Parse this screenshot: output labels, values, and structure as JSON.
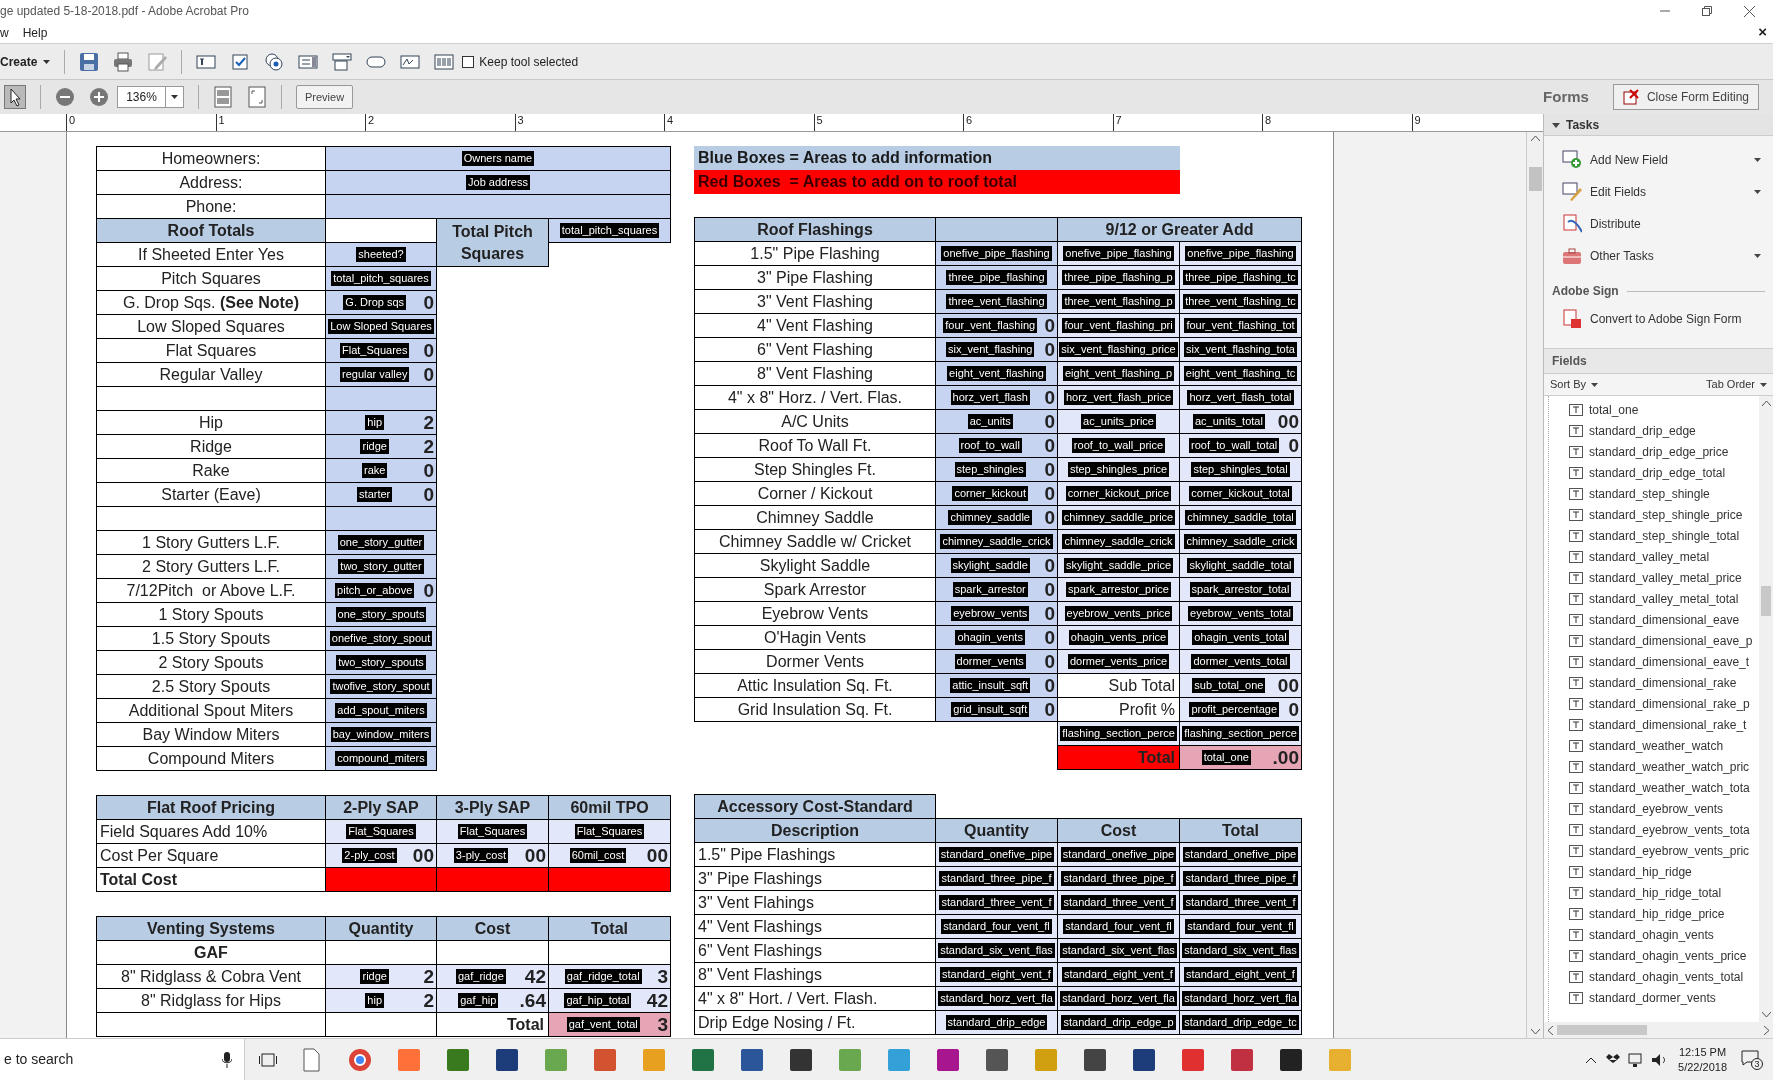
{
  "window": {
    "title": "ge updated 5-18-2018.pdf - Adobe Acrobat Pro",
    "menu": [
      "w",
      "Help"
    ],
    "menu_close": "×"
  },
  "toolbar": {
    "create": "Create",
    "keep_tool": {
      "label": "Keep tool selected",
      "checked": false
    }
  },
  "view_toolbar": {
    "zoom": "136%",
    "preview": "Preview"
  },
  "ruler": [
    "0",
    "1",
    "2",
    "3",
    "4",
    "5",
    "6",
    "7",
    "8",
    "9"
  ],
  "form": {
    "left_table": [
      [
        {
          "kind": "label",
          "text": "Homeowners:"
        },
        {
          "kind": "input_wide",
          "tag": "Owners name"
        }
      ],
      [
        {
          "kind": "label",
          "text": "Address:"
        },
        {
          "kind": "input_wide",
          "tag": "Job address"
        }
      ],
      [
        {
          "kind": "label",
          "text": "Phone:"
        },
        {
          "kind": "input_wide"
        }
      ],
      [
        {
          "kind": "header",
          "text": "Roof Totals"
        },
        {
          "kind": "blank"
        },
        {
          "kind": "header_tall",
          "text": "Total Pitch Squares"
        },
        {
          "kind": "input",
          "tag": "total_pitch_squares"
        }
      ],
      [
        {
          "kind": "label",
          "text": "If Sheeted Enter Yes"
        },
        {
          "kind": "input",
          "tag": "sheeted?"
        }
      ],
      [
        {
          "kind": "label",
          "text": "Pitch Squares"
        },
        {
          "kind": "input",
          "tag": "total_pitch_squares"
        }
      ],
      [
        {
          "kind": "label",
          "text": "G. Drop Sqs. **(See Note)**"
        },
        {
          "kind": "input",
          "tag": "G. Drop sqs",
          "value": "0"
        }
      ],
      [
        {
          "kind": "label",
          "text": "Low Sloped Squares"
        },
        {
          "kind": "input",
          "tag": "Low Sloped Squares"
        }
      ],
      [
        {
          "kind": "label",
          "text": "Flat Squares"
        },
        {
          "kind": "input",
          "tag": "Flat_Squares",
          "value": "0"
        }
      ],
      [
        {
          "kind": "label",
          "text": "Regular Valley"
        },
        {
          "kind": "input",
          "tag": "regular valley",
          "value": "0"
        }
      ],
      [
        {
          "kind": "blank"
        },
        {
          "kind": "input"
        }
      ],
      [
        {
          "kind": "label",
          "text": "Hip"
        },
        {
          "kind": "input",
          "tag": "hip",
          "value": "2"
        }
      ],
      [
        {
          "kind": "label",
          "text": "Ridge"
        },
        {
          "kind": "input",
          "tag": "ridge",
          "value": "2"
        }
      ],
      [
        {
          "kind": "label",
          "text": "Rake"
        },
        {
          "kind": "input",
          "tag": "rake",
          "value": "0"
        }
      ],
      [
        {
          "kind": "label",
          "text": "Starter (Eave)"
        },
        {
          "kind": "input",
          "tag": "starter",
          "value": "0"
        }
      ],
      [
        {
          "kind": "blank"
        },
        {
          "kind": "input"
        }
      ],
      [
        {
          "kind": "label",
          "text": "1 Story Gutters L.F."
        },
        {
          "kind": "input",
          "tag": "one_story_gutter"
        }
      ],
      [
        {
          "kind": "label",
          "text": "2 Story Gutters L.F."
        },
        {
          "kind": "input",
          "tag": "two_story_gutter"
        }
      ],
      [
        {
          "kind": "label",
          "text": "7/12Pitch  or Above L.F."
        },
        {
          "kind": "input",
          "tag": "pitch_or_above",
          "value": "0"
        }
      ],
      [
        {
          "kind": "label",
          "text": "1 Story Spouts"
        },
        {
          "kind": "input",
          "tag": "one_story_spouts"
        }
      ],
      [
        {
          "kind": "label",
          "text": "1.5 Story Spouts"
        },
        {
          "kind": "input",
          "tag": "onefive_story_spout"
        }
      ],
      [
        {
          "kind": "label",
          "text": "2 Story Spouts"
        },
        {
          "kind": "input",
          "tag": "two_story_spouts"
        }
      ],
      [
        {
          "kind": "label",
          "text": "2.5 Story Spouts"
        },
        {
          "kind": "input",
          "tag": "twofive_story_spout"
        }
      ],
      [
        {
          "kind": "label",
          "text": "Additional Spout Miters"
        },
        {
          "kind": "input",
          "tag": "add_spout_miters"
        }
      ],
      [
        {
          "kind": "label",
          "text": "Bay Window Miters"
        },
        {
          "kind": "input",
          "tag": "bay_window_miters"
        }
      ],
      [
        {
          "kind": "label",
          "text": "Compound Miters"
        },
        {
          "kind": "input",
          "tag": "compound_miters"
        }
      ]
    ],
    "flat_roof_pricing": [
      [
        {
          "kind": "header",
          "text": "Flat Roof Pricing"
        },
        {
          "kind": "header",
          "text": "2-Ply SAP"
        },
        {
          "kind": "header",
          "text": "3-Ply SAP"
        },
        {
          "kind": "header",
          "text": "60mil TPO"
        }
      ],
      [
        {
          "kind": "label_left",
          "text": "Field Squares Add 10%"
        },
        {
          "kind": "price",
          "tag": "Flat_Squares"
        },
        {
          "kind": "price",
          "tag": "Flat_Squares"
        },
        {
          "kind": "price",
          "tag": "Flat_Squares"
        }
      ],
      [
        {
          "kind": "label_left",
          "text": "Cost Per Square"
        },
        {
          "kind": "price",
          "tag": "2-ply_cost",
          "value": "00"
        },
        {
          "kind": "price",
          "tag": "3-ply_cost",
          "value": "00"
        },
        {
          "kind": "price",
          "tag": "60mil_cost",
          "value": "00"
        }
      ],
      [
        {
          "kind": "label_bold_left",
          "text": "Total Cost"
        },
        {
          "kind": "red"
        },
        {
          "kind": "red"
        },
        {
          "kind": "red"
        }
      ]
    ],
    "venting_systems": [
      [
        {
          "kind": "header",
          "text": "Venting Systems"
        },
        {
          "kind": "header",
          "text": "Quantity"
        },
        {
          "kind": "header",
          "text": "Cost"
        },
        {
          "kind": "header",
          "text": "Total"
        }
      ],
      [
        {
          "kind": "label_bold",
          "text": "GAF"
        },
        {
          "kind": "blank"
        },
        {
          "kind": "blank"
        },
        {
          "kind": "blank"
        }
      ],
      [
        {
          "kind": "label",
          "text": "8\" Ridglass & Cobra Vent"
        },
        {
          "kind": "price",
          "tag": "ridge",
          "value": "2"
        },
        {
          "kind": "price",
          "tag": "gaf_ridge",
          "value": "42"
        },
        {
          "kind": "price",
          "tag": "gaf_ridge_total",
          "value": "3"
        }
      ],
      [
        {
          "kind": "label",
          "text": "8\" Ridglass for Hips"
        },
        {
          "kind": "price",
          "tag": "hip",
          "value": "2"
        },
        {
          "kind": "price",
          "tag": "gaf_hip",
          "value": ".64"
        },
        {
          "kind": "price",
          "tag": "gaf_hip_total",
          "value": "42"
        }
      ],
      [
        {
          "kind": "blank"
        },
        {
          "kind": "blank"
        },
        {
          "kind": "label_bold_right",
          "text": "Total"
        },
        {
          "kind": "pink",
          "tag": "gaf_vent_total",
          "value": "3"
        }
      ]
    ],
    "legend": [
      {
        "kind": "info",
        "text": "Blue Boxes = Areas to add information"
      },
      {
        "kind": "warning",
        "text": "Red Boxes  = Areas to add on to roof total"
      }
    ],
    "roof_flashings": [
      [
        {
          "kind": "header",
          "text": "Roof Flashings"
        },
        {
          "kind": "header"
        },
        {
          "kind": "header_wide",
          "text": "9/12 or Greater Add"
        }
      ],
      [
        {
          "kind": "label",
          "text": "1.5\" Pipe Flashing"
        },
        {
          "kind": "input",
          "tag": "onefive_pipe_flashing"
        },
        {
          "kind": "price",
          "tag": "onefive_pipe_flashing"
        },
        {
          "kind": "price",
          "tag": "onefive_pipe_flashing"
        }
      ],
      [
        {
          "kind": "label",
          "text": "3\" Pipe Flashing"
        },
        {
          "kind": "input",
          "tag": "three_pipe_flashing"
        },
        {
          "kind": "price",
          "tag": "three_pipe_flashing_p"
        },
        {
          "kind": "price",
          "tag": "three_pipe_flashing_tc"
        }
      ],
      [
        {
          "kind": "label",
          "text": "3\" Vent Flashing"
        },
        {
          "kind": "input",
          "tag": "three_vent_flashing"
        },
        {
          "kind": "price",
          "tag": "three_vent_flashing_p"
        },
        {
          "kind": "price",
          "tag": "three_vent_flashing_tc"
        }
      ],
      [
        {
          "kind": "label",
          "text": "4\" Vent Flashing"
        },
        {
          "kind": "input",
          "tag": "four_vent_flashing",
          "value": "0"
        },
        {
          "kind": "price",
          "tag": "four_vent_flashing_pri"
        },
        {
          "kind": "price",
          "tag": "four_vent_flashing_tot"
        }
      ],
      [
        {
          "kind": "label",
          "text": "6\" Vent Flashing"
        },
        {
          "kind": "input",
          "tag": "six_vent_flashing",
          "value": "0"
        },
        {
          "kind": "price",
          "tag": "six_vent_flashing_price"
        },
        {
          "kind": "price",
          "tag": "six_vent_flashing_tota"
        }
      ],
      [
        {
          "kind": "label",
          "text": "8\" Vent Flashing"
        },
        {
          "kind": "input",
          "tag": "eight_vent_flashing"
        },
        {
          "kind": "price",
          "tag": "eight_vent_flashing_p"
        },
        {
          "kind": "price",
          "tag": "eight_vent_flashing_tc"
        }
      ],
      [
        {
          "kind": "label",
          "text": "4\" x 8\" Horz. / Vert. Flas."
        },
        {
          "kind": "input",
          "tag": "horz_vert_flash",
          "value": "0"
        },
        {
          "kind": "price",
          "tag": "horz_vert_flash_price"
        },
        {
          "kind": "price",
          "tag": "horz_vert_flash_total"
        }
      ],
      [
        {
          "kind": "label",
          "text": "A/C Units"
        },
        {
          "kind": "input",
          "tag": "ac_units",
          "value": "0"
        },
        {
          "kind": "price",
          "tag": "ac_units_price"
        },
        {
          "kind": "price",
          "tag": "ac_units_total",
          "value": "00"
        }
      ],
      [
        {
          "kind": "label",
          "text": "Roof To Wall Ft."
        },
        {
          "kind": "input",
          "tag": "roof_to_wall",
          "value": "0"
        },
        {
          "kind": "price",
          "tag": "roof_to_wall_price"
        },
        {
          "kind": "price",
          "tag": "roof_to_wall_total",
          "value": "0"
        }
      ],
      [
        {
          "kind": "label",
          "text": "Step Shingles Ft."
        },
        {
          "kind": "input",
          "tag": "step_shingles",
          "value": "0"
        },
        {
          "kind": "price",
          "tag": "step_shingles_price"
        },
        {
          "kind": "price",
          "tag": "step_shingles_total"
        }
      ],
      [
        {
          "kind": "label",
          "text": "Corner / Kickout"
        },
        {
          "kind": "input",
          "tag": "corner_kickout",
          "value": "0"
        },
        {
          "kind": "price",
          "tag": "corner_kickout_price"
        },
        {
          "kind": "price",
          "tag": "corner_kickout_total"
        }
      ],
      [
        {
          "kind": "label",
          "text": "Chimney Saddle"
        },
        {
          "kind": "input",
          "tag": "chimney_saddle",
          "value": "0"
        },
        {
          "kind": "price",
          "tag": "chimney_saddle_price"
        },
        {
          "kind": "price",
          "tag": "chimney_saddle_total"
        }
      ],
      [
        {
          "kind": "label",
          "text": "Chimney Saddle w/ Cricket"
        },
        {
          "kind": "input",
          "tag": "chimney_saddle_crick"
        },
        {
          "kind": "price",
          "tag": "chimney_saddle_crick"
        },
        {
          "kind": "price",
          "tag": "chimney_saddle_crick"
        }
      ],
      [
        {
          "kind": "label",
          "text": "Skylight Saddle"
        },
        {
          "kind": "input",
          "tag": "skylight_saddle",
          "value": "0"
        },
        {
          "kind": "price",
          "tag": "skylight_saddle_price"
        },
        {
          "kind": "price",
          "tag": "skylight_saddle_total"
        }
      ],
      [
        {
          "kind": "label",
          "text": "Spark Arrestor"
        },
        {
          "kind": "input",
          "tag": "spark_arrestor",
          "value": "0"
        },
        {
          "kind": "price",
          "tag": "spark_arrestor_price"
        },
        {
          "kind": "price",
          "tag": "spark_arrestor_total"
        }
      ],
      [
        {
          "kind": "label",
          "text": "Eyebrow Vents"
        },
        {
          "kind": "input",
          "tag": "eyebrow_vents",
          "value": "0"
        },
        {
          "kind": "price",
          "tag": "eyebrow_vents_price"
        },
        {
          "kind": "price",
          "tag": "eyebrow_vents_total"
        }
      ],
      [
        {
          "kind": "label",
          "text": "O'Hagin Vents"
        },
        {
          "kind": "input",
          "tag": "ohagin_vents",
          "value": "0"
        },
        {
          "kind": "price",
          "tag": "ohagin_vents_price"
        },
        {
          "kind": "price",
          "tag": "ohagin_vents_total"
        }
      ],
      [
        {
          "kind": "label",
          "text": "Dormer Vents"
        },
        {
          "kind": "input",
          "tag": "dormer_vents",
          "value": "0"
        },
        {
          "kind": "price",
          "tag": "dormer_vents_price"
        },
        {
          "kind": "price",
          "tag": "dormer_vents_total"
        }
      ],
      [
        {
          "kind": "label",
          "text": "Attic Insulation Sq. Ft."
        },
        {
          "kind": "input",
          "tag": "attic_insult_sqft",
          "value": "0"
        },
        {
          "kind": "label_right",
          "text": "Sub Total"
        },
        {
          "kind": "price",
          "tag": "sub_total_one",
          "value": "00"
        }
      ],
      [
        {
          "kind": "label",
          "text": "Grid Insulation Sq. Ft."
        },
        {
          "kind": "input",
          "tag": "grid_insult_sqft",
          "value": "0"
        },
        {
          "kind": "label_right",
          "text": "Profit %"
        },
        {
          "kind": "price",
          "tag": "profit_percentage",
          "value": "0"
        }
      ],
      [
        {
          "kind": "none"
        },
        {
          "kind": "none"
        },
        {
          "kind": "price",
          "tag": "flashing_section_perce"
        },
        {
          "kind": "price",
          "tag": "flashing_section_perce"
        }
      ],
      [
        {
          "kind": "none"
        },
        {
          "kind": "none"
        },
        {
          "kind": "red",
          "text": "Total"
        },
        {
          "kind": "pink",
          "tag": "total_one",
          "value": ".00"
        }
      ]
    ],
    "accessory_cost": [
      [
        {
          "kind": "header",
          "text": "Accessory Cost-Standard"
        },
        {
          "kind": "none"
        },
        {
          "kind": "none"
        },
        {
          "kind": "none"
        }
      ],
      [
        {
          "kind": "header",
          "text": "Description"
        },
        {
          "kind": "header",
          "text": "Quantity"
        },
        {
          "kind": "header",
          "text": "Cost"
        },
        {
          "kind": "header",
          "text": "Total"
        }
      ],
      [
        {
          "kind": "label_left",
          "text": "1.5\" Pipe Flashings"
        },
        {
          "kind": "price",
          "tag": "standard_onefive_pipe"
        },
        {
          "kind": "price",
          "tag": "standard_onefive_pipe"
        },
        {
          "kind": "price",
          "tag": "standard_onefive_pipe"
        }
      ],
      [
        {
          "kind": "label_left",
          "text": "3\" Pipe Flashings"
        },
        {
          "kind": "price",
          "tag": "standard_three_pipe_f"
        },
        {
          "kind": "price",
          "tag": "standard_three_pipe_f"
        },
        {
          "kind": "price",
          "tag": "standard_three_pipe_f"
        }
      ],
      [
        {
          "kind": "label_left",
          "text": "3\" Vent Flahings"
        },
        {
          "kind": "price",
          "tag": "standard_three_vent_f"
        },
        {
          "kind": "price",
          "tag": "standard_three_vent_f"
        },
        {
          "kind": "price",
          "tag": "standard_three_vent_f"
        }
      ],
      [
        {
          "kind": "label_left",
          "text": "4\" Vent Flashings"
        },
        {
          "kind": "price",
          "tag": "standard_four_vent_fl"
        },
        {
          "kind": "price",
          "tag": "standard_four_vent_fl"
        },
        {
          "kind": "price",
          "tag": "standard_four_vent_fl"
        }
      ],
      [
        {
          "kind": "label_left",
          "text": "6\" Vent Flashings"
        },
        {
          "kind": "price",
          "tag": "standard_six_vent_flas"
        },
        {
          "kind": "price",
          "tag": "standard_six_vent_flas"
        },
        {
          "kind": "price",
          "tag": "standard_six_vent_flas"
        }
      ],
      [
        {
          "kind": "label_left",
          "text": "8\" Vent Flashings"
        },
        {
          "kind": "price",
          "tag": "standard_eight_vent_f"
        },
        {
          "kind": "price",
          "tag": "standard_eight_vent_f"
        },
        {
          "kind": "price",
          "tag": "standard_eight_vent_f"
        }
      ],
      [
        {
          "kind": "label_left",
          "text": "4\" x 8\" Hort. / Vert. Flash."
        },
        {
          "kind": "price",
          "tag": "standard_horz_vert_fla"
        },
        {
          "kind": "price",
          "tag": "standard_horz_vert_fla"
        },
        {
          "kind": "price",
          "tag": "standard_horz_vert_fla"
        }
      ],
      [
        {
          "kind": "label_left",
          "text": "Drip Edge Nosing / Ft."
        },
        {
          "kind": "price",
          "tag": "standard_drip_edge"
        },
        {
          "kind": "price",
          "tag": "standard_drip_edge_p"
        },
        {
          "kind": "price",
          "tag": "standard_drip_edge_tc"
        }
      ]
    ]
  },
  "forms_panel": {
    "title": "Forms",
    "close_button": "Close Form Editing",
    "tasks": {
      "title": "Tasks",
      "expanded": true,
      "items": [
        {
          "label": "Add New Field",
          "menu": true
        },
        {
          "label": "Edit Fields",
          "menu": true
        },
        {
          "label": "Distribute",
          "menu": false
        },
        {
          "label": "Other Tasks",
          "menu": true
        }
      ]
    },
    "adobe_sign": {
      "title": "Adobe Sign",
      "items": [
        "Convert to Adobe Sign Form"
      ]
    },
    "fields": {
      "title": "Fields",
      "sort_by": "Sort By",
      "tab_order": "Tab Order",
      "items": [
        "total_one",
        "standard_drip_edge",
        "standard_drip_edge_price",
        "standard_drip_edge_total",
        "standard_step_shingle",
        "standard_step_shingle_price",
        "standard_step_shingle_total",
        "standard_valley_metal",
        "standard_valley_metal_price",
        "standard_valley_metal_total",
        "standard_dimensional_eave",
        "standard_dimensional_eave_p",
        "standard_dimensional_eave_t",
        "standard_dimensional_rake",
        "standard_dimensional_rake_p",
        "standard_dimensional_rake_t",
        "standard_weather_watch",
        "standard_weather_watch_pric",
        "standard_weather_watch_tota",
        "standard_eyebrow_vents",
        "standard_eyebrow_vents_tota",
        "standard_eyebrow_vents_pric",
        "standard_hip_ridge",
        "standard_hip_ridge_total",
        "standard_hip_ridge_price",
        "standard_ohagin_vents",
        "standard_ohagin_vents_price",
        "standard_ohagin_vents_total",
        "standard_dormer_vents"
      ]
    }
  },
  "taskbar": {
    "search": "e to search",
    "time": "12:15 PM",
    "date": "5/22/2018",
    "notifications": "3"
  }
}
